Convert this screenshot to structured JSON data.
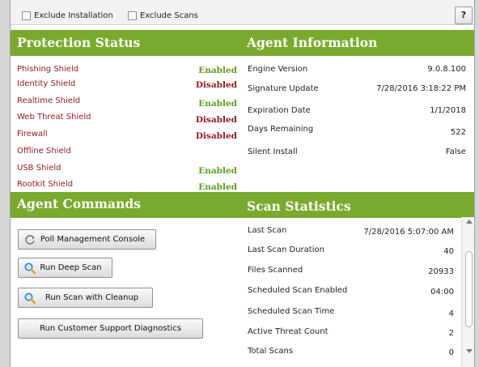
{
  "toolbar": {
    "exclude_installation": "Exclude Installation",
    "exclude_scans": "Exclude Scans",
    "help": "?"
  },
  "protection": {
    "title": "Protection Status",
    "rows": [
      {
        "name": "Phishing Shield",
        "state": "Enabled"
      },
      {
        "name": "Identity Shield",
        "state": "Disabled"
      },
      {
        "name": "Realtime Shield",
        "state": "Enabled"
      },
      {
        "name": "Web Threat Shield",
        "state": "Disabled"
      },
      {
        "name": "Firewall",
        "state": "Disabled"
      },
      {
        "name": "Offline Shield",
        "state": ""
      },
      {
        "name": "USB Shield",
        "state": "Enabled"
      },
      {
        "name": "Rootkit Shield",
        "state": "Enabled"
      }
    ]
  },
  "agent_info": {
    "title": "Agent Information",
    "rows": [
      {
        "key": "Engine Version",
        "value": "9.0.8.100"
      },
      {
        "key": "Signature Update",
        "value": "7/28/2016 3:18:22 PM"
      },
      {
        "key": "Expiration Date",
        "value": "1/1/2018"
      },
      {
        "key": "Days Remaining",
        "value": "522"
      },
      {
        "key": "Silent Install",
        "value": "False"
      }
    ]
  },
  "commands": {
    "title": "Agent Commands",
    "poll": "Poll Management Console",
    "deep_scan": "Run Deep Scan",
    "scan_cleanup": "Run Scan with Cleanup",
    "diagnostics": "Run Customer Support Diagnostics"
  },
  "scan_stats": {
    "title": "Scan Statistics",
    "rows": [
      {
        "key": "Last Scan",
        "value": "7/28/2016 5:07:00 AM"
      },
      {
        "key": "Last Scan Duration",
        "value": "40"
      },
      {
        "key": "Files Scanned",
        "value": "20933"
      },
      {
        "key": "Scheduled Scan Enabled",
        "value": "04:00"
      },
      {
        "key": "Scheduled Scan Time",
        "value": "4"
      },
      {
        "key": "Active Threat Count",
        "value": "2"
      },
      {
        "key": "Total Scans",
        "value": "0"
      }
    ]
  },
  "colors": {
    "band": "#79aa2d",
    "enabled": "#5e9a1f",
    "disabled": "#8b1a1a",
    "shield_name": "#8b1a1a"
  },
  "icons": {
    "poll": "refresh-icon",
    "deep_scan": "magnifier-icon",
    "scan_cleanup": "magnifier-icon"
  }
}
